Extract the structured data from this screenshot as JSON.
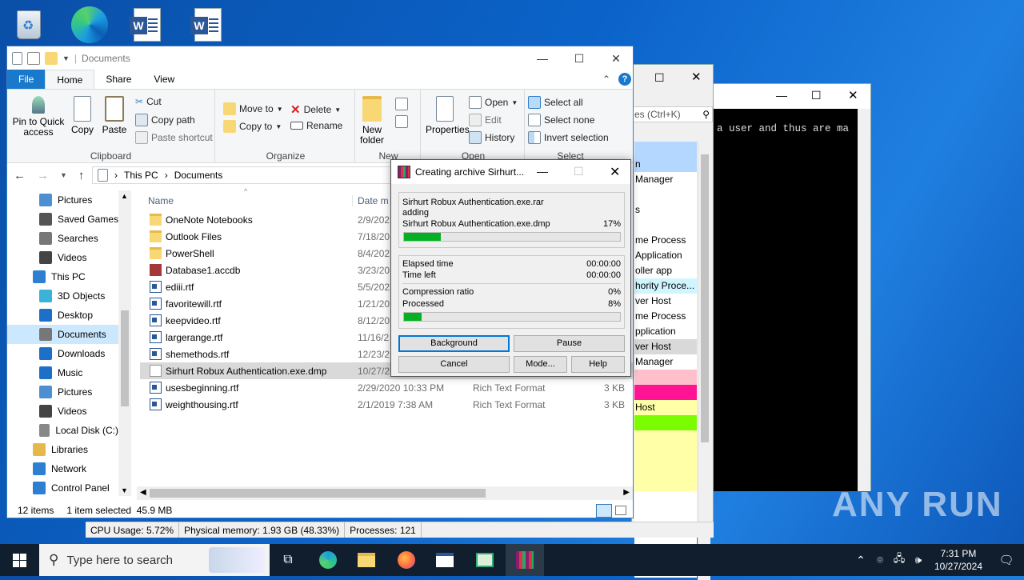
{
  "desktop": {
    "watermark": "ANY RUN"
  },
  "console": {
    "text": "a user and thus are ma"
  },
  "taskmgr": {
    "search_placeholder": "es (Ctrl+K)",
    "rows": [
      {
        "label": "",
        "color": "#b3d7ff"
      },
      {
        "label": "n",
        "color": "#b3d7ff"
      },
      {
        "label": "Manager",
        "color": "#ffffff"
      },
      {
        "label": "",
        "color": "#ffffff"
      },
      {
        "label": "s",
        "color": "#ffffff"
      },
      {
        "label": "",
        "color": "#ffffff"
      },
      {
        "label": "me Process",
        "color": "#ffffff"
      },
      {
        "label": " Application",
        "color": "#ffffff"
      },
      {
        "label": "oller app",
        "color": "#ffffff"
      },
      {
        "label": "hority Proce...",
        "color": "#d0f5ff"
      },
      {
        "label": "ver Host",
        "color": "#ffffff"
      },
      {
        "label": "me Process",
        "color": "#ffffff"
      },
      {
        "label": "pplication",
        "color": "#ffffff"
      },
      {
        "label": "ver Host",
        "color": "#d9d9d9"
      },
      {
        "label": "Manager",
        "color": "#ffffff"
      },
      {
        "label": "",
        "color": "#ffc0cb"
      },
      {
        "label": "",
        "color": "#ff1493"
      },
      {
        "label": "Host",
        "color": "#ffffa8"
      },
      {
        "label": "",
        "color": "#7cfc00"
      },
      {
        "label": "",
        "color": "#ffffa8"
      },
      {
        "label": "",
        "color": "#ffffa8"
      },
      {
        "label": "",
        "color": "#ffffa8"
      },
      {
        "label": "",
        "color": "#ffffa8"
      }
    ],
    "status": {
      "cpu": "CPU Usage: 5.72%",
      "memory": "Physical memory: 1.93 GB (48.33%)",
      "processes": "Processes: 121"
    }
  },
  "explorer": {
    "title": "Documents",
    "tabs": {
      "file": "File",
      "home": "Home",
      "share": "Share",
      "view": "View"
    },
    "ribbon": {
      "pin": "Pin to Quick access",
      "copy": "Copy",
      "paste": "Paste",
      "cut": "Cut",
      "copy_path": "Copy path",
      "paste_shortcut": "Paste shortcut",
      "clipboard": "Clipboard",
      "move_to": "Move to",
      "copy_to": "Copy to",
      "delete": "Delete",
      "rename": "Rename",
      "organize": "Organize",
      "new_folder": "New folder",
      "new": "New",
      "properties": "Properties",
      "open": "Open",
      "edit": "Edit",
      "history": "History",
      "open_group": "Open",
      "select_all": "Select all",
      "select_none": "Select none",
      "invert_selection": "Invert selection",
      "select": "Select"
    },
    "breadcrumb": [
      "This PC",
      "Documents"
    ],
    "nav": [
      {
        "label": "Pictures",
        "indent": 1,
        "color": "#4d8fd1"
      },
      {
        "label": "Saved Games",
        "indent": 1,
        "color": "#555"
      },
      {
        "label": "Searches",
        "indent": 1,
        "color": "#777"
      },
      {
        "label": "Videos",
        "indent": 1,
        "color": "#444"
      },
      {
        "label": "This PC",
        "indent": 0,
        "color": "#2d7fd1"
      },
      {
        "label": "3D Objects",
        "indent": 1,
        "color": "#3bb3d8"
      },
      {
        "label": "Desktop",
        "indent": 1,
        "color": "#1e6fc7"
      },
      {
        "label": "Documents",
        "indent": 1,
        "color": "#777",
        "selected": true
      },
      {
        "label": "Downloads",
        "indent": 1,
        "color": "#1e6fc7"
      },
      {
        "label": "Music",
        "indent": 1,
        "color": "#1e6fc7"
      },
      {
        "label": "Pictures",
        "indent": 1,
        "color": "#4d8fd1"
      },
      {
        "label": "Videos",
        "indent": 1,
        "color": "#444"
      },
      {
        "label": "Local Disk (C:)",
        "indent": 1,
        "color": "#888"
      },
      {
        "label": "Libraries",
        "indent": 0,
        "color": "#e6b84a"
      },
      {
        "label": "Network",
        "indent": 0,
        "color": "#2d7fd1"
      },
      {
        "label": "Control Panel",
        "indent": 0,
        "color": "#2d7fd1"
      }
    ],
    "columns": {
      "name": "Name",
      "date": "Date m"
    },
    "files": [
      {
        "name": "OneNote Notebooks",
        "date": "2/9/202",
        "type": "",
        "size": "",
        "kind": "folder"
      },
      {
        "name": "Outlook Files",
        "date": "7/18/20",
        "type": "",
        "size": "",
        "kind": "folder"
      },
      {
        "name": "PowerShell",
        "date": "8/4/202",
        "type": "",
        "size": "",
        "kind": "folder"
      },
      {
        "name": "Database1.accdb",
        "date": "3/23/20",
        "type": "",
        "size": "",
        "kind": "accdb"
      },
      {
        "name": "ediii.rtf",
        "date": "5/5/202",
        "type": "",
        "size": "",
        "kind": "rtf"
      },
      {
        "name": "favoritewill.rtf",
        "date": "1/21/20",
        "type": "",
        "size": "",
        "kind": "rtf"
      },
      {
        "name": "keepvideo.rtf",
        "date": "8/12/20",
        "type": "",
        "size": "",
        "kind": "rtf"
      },
      {
        "name": "largerange.rtf",
        "date": "11/16/2",
        "type": "",
        "size": "",
        "kind": "rtf"
      },
      {
        "name": "shemethods.rtf",
        "date": "12/23/2",
        "type": "",
        "size": "",
        "kind": "rtf"
      },
      {
        "name": "Sirhurt Robux Authentication.exe.dmp",
        "date": "10/27/2",
        "type": "",
        "size": "",
        "kind": "dmp",
        "selected": true
      },
      {
        "name": "usesbeginning.rtf",
        "date": "2/29/2020 10:33 PM",
        "type": "Rich Text Format",
        "size": "3 KB",
        "kind": "rtf"
      },
      {
        "name": "weighthousing.rtf",
        "date": "2/1/2019 7:38 AM",
        "type": "Rich Text Format",
        "size": "3 KB",
        "kind": "rtf"
      }
    ],
    "status": {
      "count": "12 items",
      "selection": "1 item selected  45.9 MB"
    }
  },
  "rar": {
    "title": "Creating archive Sirhurt...",
    "archive": "Sirhurt Robux Authentication.exe.rar",
    "action": "adding",
    "file": "Sirhurt Robux Authentication.exe.dmp",
    "file_pct": "17%",
    "file_progress": 0.17,
    "elapsed_label": "Elapsed time",
    "elapsed": "00:00:00",
    "left_label": "Time left",
    "left": "00:00:00",
    "ratio_label": "Compression ratio",
    "ratio": "0%",
    "processed_label": "Processed",
    "processed": "8%",
    "total_progress": 0.08,
    "buttons": {
      "background": "Background",
      "pause": "Pause",
      "cancel": "Cancel",
      "mode": "Mode...",
      "help": "Help"
    }
  },
  "taskbar": {
    "search_placeholder": "Type here to search",
    "time": "7:31 PM",
    "date": "10/27/2024"
  }
}
